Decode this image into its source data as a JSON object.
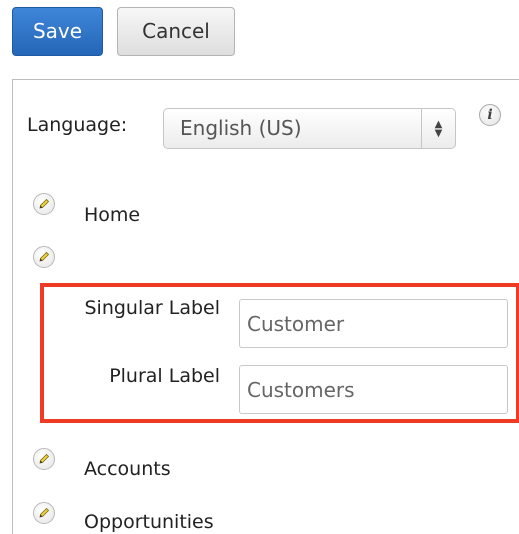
{
  "toolbar": {
    "save_label": "Save",
    "cancel_label": "Cancel"
  },
  "language": {
    "label": "Language:",
    "selected": "English (US)",
    "info_glyph": "i"
  },
  "modules": [
    {
      "label": "Home"
    },
    {
      "label": ""
    },
    {
      "label": "Accounts"
    },
    {
      "label": "Opportunities"
    }
  ],
  "edit_panel": {
    "singular_label": "Singular Label",
    "singular_value": "Customer",
    "plural_label": "Plural Label",
    "plural_value": "Customers"
  },
  "colors": {
    "primary_button": "#2a6fc4",
    "highlight_border": "#f03b24"
  },
  "icons": {
    "edit": "pencil-icon",
    "info": "info-icon",
    "select_arrows": "up-down-arrows-icon"
  }
}
